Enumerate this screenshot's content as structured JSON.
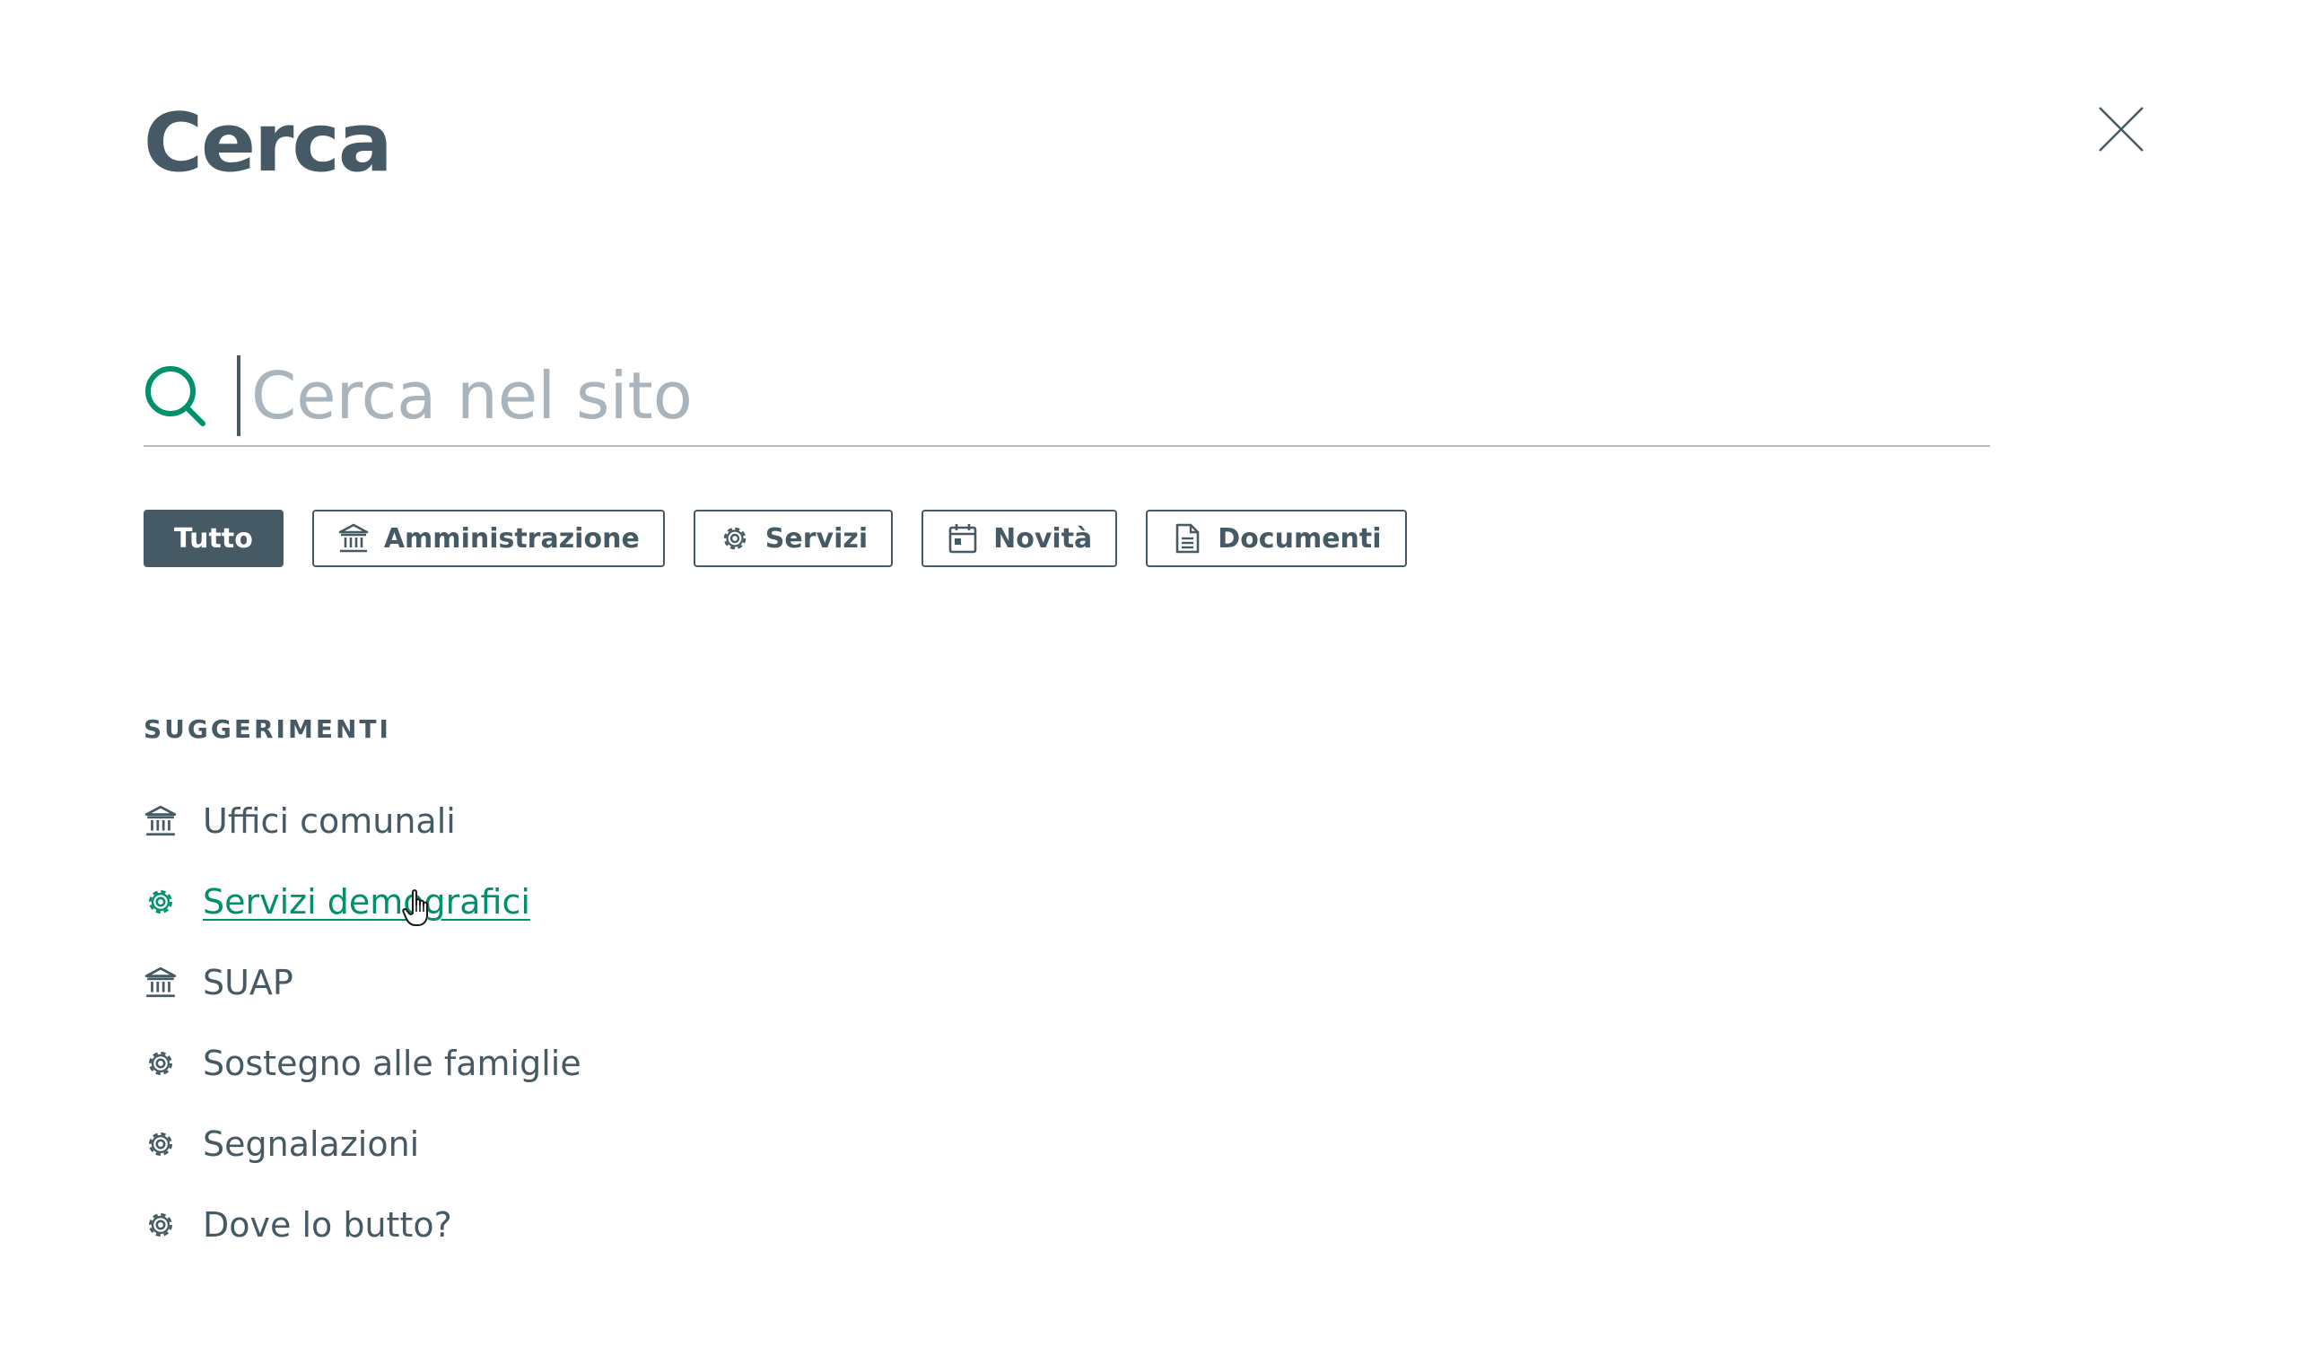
{
  "header": {
    "title": "Cerca",
    "close_icon": "close-icon"
  },
  "search": {
    "placeholder": "Cerca nel sito",
    "value": "",
    "icon": "search-icon"
  },
  "filters": [
    {
      "label": "Tutto",
      "active": true,
      "icon": null
    },
    {
      "label": "Amministrazione",
      "active": false,
      "icon": "building-icon"
    },
    {
      "label": "Servizi",
      "active": false,
      "icon": "gear-icon"
    },
    {
      "label": "Novità",
      "active": false,
      "icon": "calendar-icon"
    },
    {
      "label": "Documenti",
      "active": false,
      "icon": "document-icon"
    }
  ],
  "suggestions": {
    "heading": "SUGGERIMENTI",
    "items": [
      {
        "label": "Uffici comunali",
        "icon": "building-icon",
        "hover": false
      },
      {
        "label": "Servizi demografici",
        "icon": "gear-icon",
        "hover": true
      },
      {
        "label": "SUAP",
        "icon": "building-icon",
        "hover": false
      },
      {
        "label": "Sostegno alle famiglie",
        "icon": "gear-icon",
        "hover": false
      },
      {
        "label": "Segnalazioni",
        "icon": "gear-icon",
        "hover": false
      },
      {
        "label": "Dove lo butto?",
        "icon": "gear-icon",
        "hover": false
      }
    ]
  },
  "colors": {
    "primary_text": "#455a64",
    "accent_green": "#00906b",
    "placeholder": "#a9b4bc",
    "divider": "#b4bcc2"
  }
}
